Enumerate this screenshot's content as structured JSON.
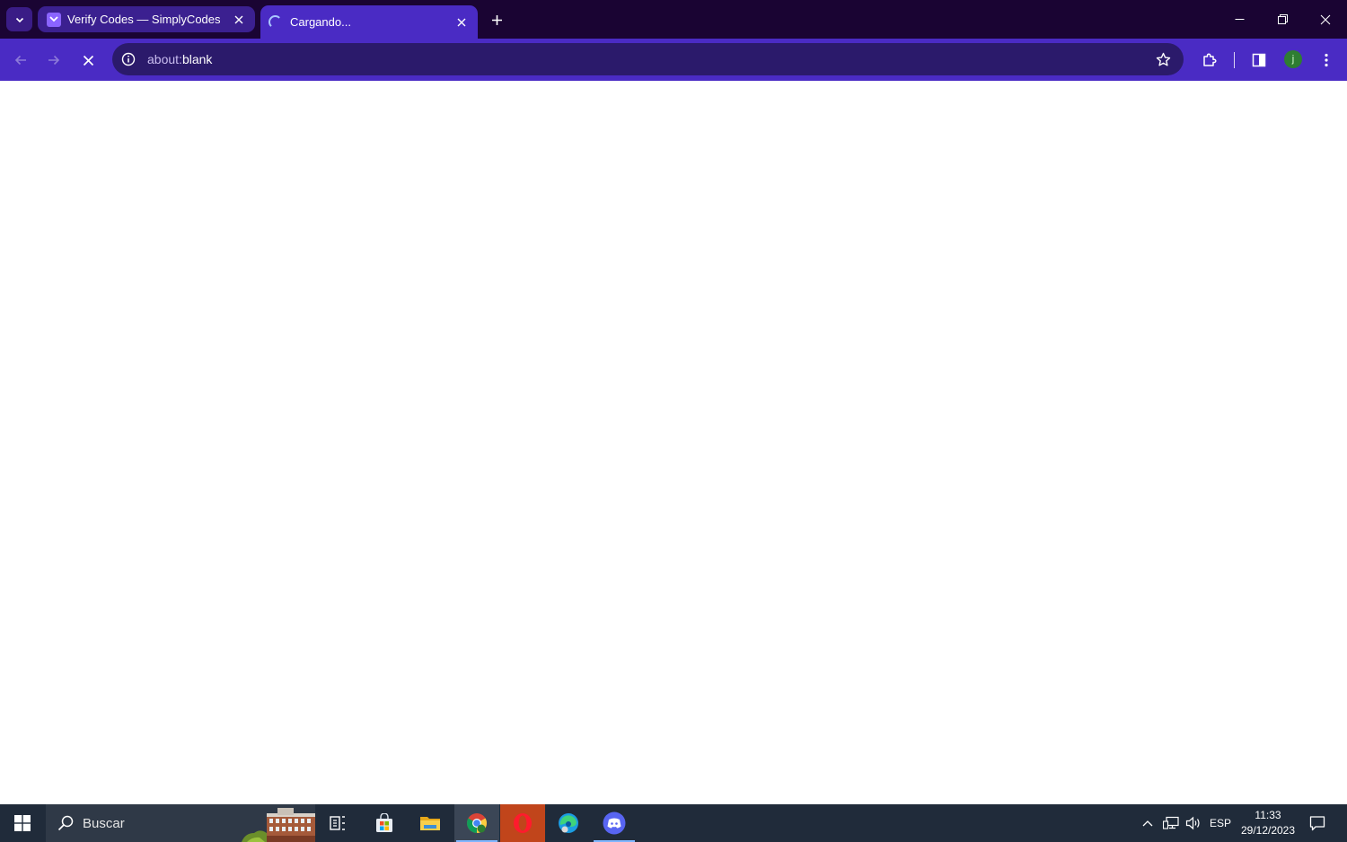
{
  "browser": {
    "tabs": [
      {
        "title": "Verify Codes — SimplyCodes",
        "favicon": "simplycodes-icon",
        "active": false
      },
      {
        "title": "Cargando...",
        "favicon": "loading-spinner-icon",
        "active": true
      }
    ],
    "address_bar": {
      "scheme": "about:",
      "host": "blank"
    },
    "profile_initial": "j",
    "colors": {
      "titlebar": "#1a0433",
      "toolbar": "#4a2bc4",
      "omnibox": "#2b1a6b"
    }
  },
  "taskbar": {
    "search_label": "Buscar",
    "apps": [
      "task-view",
      "microsoft-store",
      "file-explorer",
      "chrome",
      "opera",
      "edge",
      "discord"
    ],
    "tray": {
      "language": "ESP",
      "time": "11:33",
      "date": "29/12/2023"
    }
  }
}
